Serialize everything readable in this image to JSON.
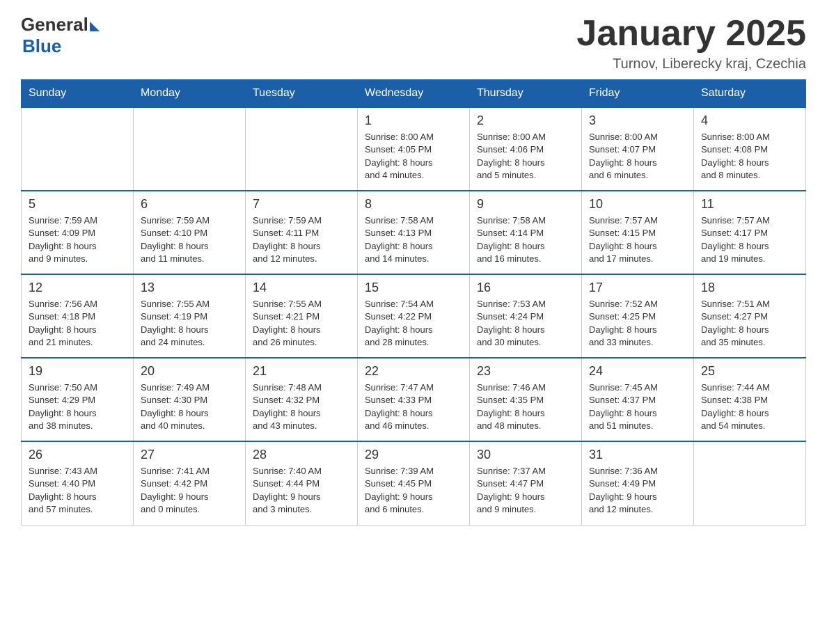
{
  "header": {
    "logo_general": "General",
    "logo_blue": "Blue",
    "month_title": "January 2025",
    "location": "Turnov, Liberecky kraj, Czechia"
  },
  "days_of_week": [
    "Sunday",
    "Monday",
    "Tuesday",
    "Wednesday",
    "Thursday",
    "Friday",
    "Saturday"
  ],
  "weeks": [
    [
      {
        "day": "",
        "info": ""
      },
      {
        "day": "",
        "info": ""
      },
      {
        "day": "",
        "info": ""
      },
      {
        "day": "1",
        "info": "Sunrise: 8:00 AM\nSunset: 4:05 PM\nDaylight: 8 hours\nand 4 minutes."
      },
      {
        "day": "2",
        "info": "Sunrise: 8:00 AM\nSunset: 4:06 PM\nDaylight: 8 hours\nand 5 minutes."
      },
      {
        "day": "3",
        "info": "Sunrise: 8:00 AM\nSunset: 4:07 PM\nDaylight: 8 hours\nand 6 minutes."
      },
      {
        "day": "4",
        "info": "Sunrise: 8:00 AM\nSunset: 4:08 PM\nDaylight: 8 hours\nand 8 minutes."
      }
    ],
    [
      {
        "day": "5",
        "info": "Sunrise: 7:59 AM\nSunset: 4:09 PM\nDaylight: 8 hours\nand 9 minutes."
      },
      {
        "day": "6",
        "info": "Sunrise: 7:59 AM\nSunset: 4:10 PM\nDaylight: 8 hours\nand 11 minutes."
      },
      {
        "day": "7",
        "info": "Sunrise: 7:59 AM\nSunset: 4:11 PM\nDaylight: 8 hours\nand 12 minutes."
      },
      {
        "day": "8",
        "info": "Sunrise: 7:58 AM\nSunset: 4:13 PM\nDaylight: 8 hours\nand 14 minutes."
      },
      {
        "day": "9",
        "info": "Sunrise: 7:58 AM\nSunset: 4:14 PM\nDaylight: 8 hours\nand 16 minutes."
      },
      {
        "day": "10",
        "info": "Sunrise: 7:57 AM\nSunset: 4:15 PM\nDaylight: 8 hours\nand 17 minutes."
      },
      {
        "day": "11",
        "info": "Sunrise: 7:57 AM\nSunset: 4:17 PM\nDaylight: 8 hours\nand 19 minutes."
      }
    ],
    [
      {
        "day": "12",
        "info": "Sunrise: 7:56 AM\nSunset: 4:18 PM\nDaylight: 8 hours\nand 21 minutes."
      },
      {
        "day": "13",
        "info": "Sunrise: 7:55 AM\nSunset: 4:19 PM\nDaylight: 8 hours\nand 24 minutes."
      },
      {
        "day": "14",
        "info": "Sunrise: 7:55 AM\nSunset: 4:21 PM\nDaylight: 8 hours\nand 26 minutes."
      },
      {
        "day": "15",
        "info": "Sunrise: 7:54 AM\nSunset: 4:22 PM\nDaylight: 8 hours\nand 28 minutes."
      },
      {
        "day": "16",
        "info": "Sunrise: 7:53 AM\nSunset: 4:24 PM\nDaylight: 8 hours\nand 30 minutes."
      },
      {
        "day": "17",
        "info": "Sunrise: 7:52 AM\nSunset: 4:25 PM\nDaylight: 8 hours\nand 33 minutes."
      },
      {
        "day": "18",
        "info": "Sunrise: 7:51 AM\nSunset: 4:27 PM\nDaylight: 8 hours\nand 35 minutes."
      }
    ],
    [
      {
        "day": "19",
        "info": "Sunrise: 7:50 AM\nSunset: 4:29 PM\nDaylight: 8 hours\nand 38 minutes."
      },
      {
        "day": "20",
        "info": "Sunrise: 7:49 AM\nSunset: 4:30 PM\nDaylight: 8 hours\nand 40 minutes."
      },
      {
        "day": "21",
        "info": "Sunrise: 7:48 AM\nSunset: 4:32 PM\nDaylight: 8 hours\nand 43 minutes."
      },
      {
        "day": "22",
        "info": "Sunrise: 7:47 AM\nSunset: 4:33 PM\nDaylight: 8 hours\nand 46 minutes."
      },
      {
        "day": "23",
        "info": "Sunrise: 7:46 AM\nSunset: 4:35 PM\nDaylight: 8 hours\nand 48 minutes."
      },
      {
        "day": "24",
        "info": "Sunrise: 7:45 AM\nSunset: 4:37 PM\nDaylight: 8 hours\nand 51 minutes."
      },
      {
        "day": "25",
        "info": "Sunrise: 7:44 AM\nSunset: 4:38 PM\nDaylight: 8 hours\nand 54 minutes."
      }
    ],
    [
      {
        "day": "26",
        "info": "Sunrise: 7:43 AM\nSunset: 4:40 PM\nDaylight: 8 hours\nand 57 minutes."
      },
      {
        "day": "27",
        "info": "Sunrise: 7:41 AM\nSunset: 4:42 PM\nDaylight: 9 hours\nand 0 minutes."
      },
      {
        "day": "28",
        "info": "Sunrise: 7:40 AM\nSunset: 4:44 PM\nDaylight: 9 hours\nand 3 minutes."
      },
      {
        "day": "29",
        "info": "Sunrise: 7:39 AM\nSunset: 4:45 PM\nDaylight: 9 hours\nand 6 minutes."
      },
      {
        "day": "30",
        "info": "Sunrise: 7:37 AM\nSunset: 4:47 PM\nDaylight: 9 hours\nand 9 minutes."
      },
      {
        "day": "31",
        "info": "Sunrise: 7:36 AM\nSunset: 4:49 PM\nDaylight: 9 hours\nand 12 minutes."
      },
      {
        "day": "",
        "info": ""
      }
    ]
  ]
}
